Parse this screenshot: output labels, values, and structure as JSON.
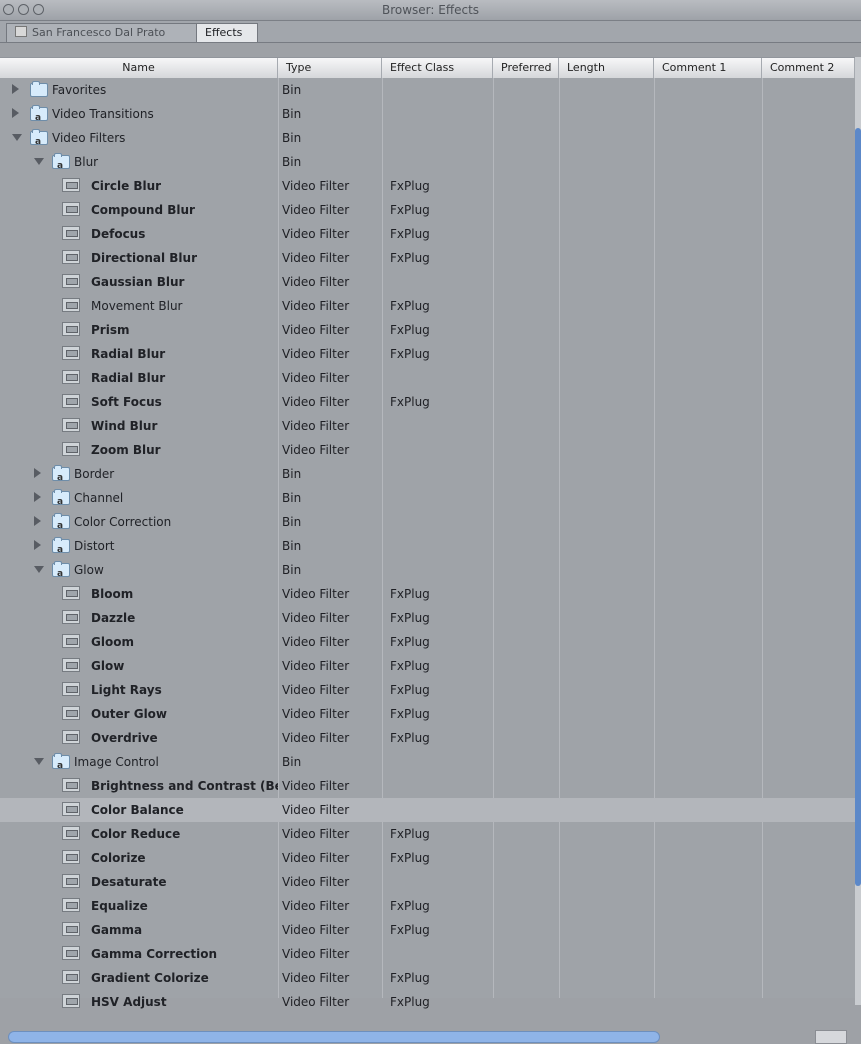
{
  "window_title": "Browser: Effects",
  "tabs": [
    {
      "label": "San Francesco Dal Prato"
    },
    {
      "label": "Effects"
    }
  ],
  "columns": [
    "Name",
    "Type",
    "Effect Class",
    "Preferred",
    "Length",
    "Comment 1",
    "Comment 2"
  ],
  "rows": [
    {
      "name": "Favorites",
      "type": "Bin",
      "class": "",
      "level": 0,
      "disclosure": "collapsed",
      "icon": "folder"
    },
    {
      "name": "Video Transitions",
      "type": "Bin",
      "class": "",
      "level": 0,
      "disclosure": "collapsed",
      "icon": "lock-folder"
    },
    {
      "name": "Video Filters",
      "type": "Bin",
      "class": "",
      "level": 0,
      "disclosure": "expanded",
      "icon": "lock-folder"
    },
    {
      "name": "Blur",
      "type": "Bin",
      "class": "",
      "level": 1,
      "disclosure": "expanded",
      "icon": "lock-folder"
    },
    {
      "name": "Circle Blur",
      "type": "Video Filter",
      "class": "FxPlug",
      "level": 2,
      "icon": "filter",
      "bold": true
    },
    {
      "name": "Compound Blur",
      "type": "Video Filter",
      "class": "FxPlug",
      "level": 2,
      "icon": "filter",
      "bold": true
    },
    {
      "name": "Defocus",
      "type": "Video Filter",
      "class": "FxPlug",
      "level": 2,
      "icon": "filter",
      "bold": true
    },
    {
      "name": "Directional Blur",
      "type": "Video Filter",
      "class": "FxPlug",
      "level": 2,
      "icon": "filter",
      "bold": true
    },
    {
      "name": "Gaussian Blur",
      "type": "Video Filter",
      "class": "",
      "level": 2,
      "icon": "filter",
      "bold": true
    },
    {
      "name": "Movement Blur",
      "type": "Video Filter",
      "class": "FxPlug",
      "level": 2,
      "icon": "filter",
      "bold": false
    },
    {
      "name": "Prism",
      "type": "Video Filter",
      "class": "FxPlug",
      "level": 2,
      "icon": "filter",
      "bold": true
    },
    {
      "name": "Radial Blur",
      "type": "Video Filter",
      "class": "FxPlug",
      "level": 2,
      "icon": "filter",
      "bold": true
    },
    {
      "name": "Radial Blur",
      "type": "Video Filter",
      "class": "",
      "level": 2,
      "icon": "filter",
      "bold": true
    },
    {
      "name": "Soft Focus",
      "type": "Video Filter",
      "class": "FxPlug",
      "level": 2,
      "icon": "filter",
      "bold": true
    },
    {
      "name": "Wind Blur",
      "type": "Video Filter",
      "class": "",
      "level": 2,
      "icon": "filter",
      "bold": true
    },
    {
      "name": "Zoom Blur",
      "type": "Video Filter",
      "class": "",
      "level": 2,
      "icon": "filter",
      "bold": true
    },
    {
      "name": "Border",
      "type": "Bin",
      "class": "",
      "level": 1,
      "disclosure": "collapsed",
      "icon": "lock-folder"
    },
    {
      "name": "Channel",
      "type": "Bin",
      "class": "",
      "level": 1,
      "disclosure": "collapsed",
      "icon": "lock-folder"
    },
    {
      "name": "Color Correction",
      "type": "Bin",
      "class": "",
      "level": 1,
      "disclosure": "collapsed",
      "icon": "lock-folder"
    },
    {
      "name": "Distort",
      "type": "Bin",
      "class": "",
      "level": 1,
      "disclosure": "collapsed",
      "icon": "lock-folder"
    },
    {
      "name": "Glow",
      "type": "Bin",
      "class": "",
      "level": 1,
      "disclosure": "expanded",
      "icon": "lock-folder"
    },
    {
      "name": "Bloom",
      "type": "Video Filter",
      "class": "FxPlug",
      "level": 2,
      "icon": "filter",
      "bold": true
    },
    {
      "name": "Dazzle",
      "type": "Video Filter",
      "class": "FxPlug",
      "level": 2,
      "icon": "filter",
      "bold": true
    },
    {
      "name": "Gloom",
      "type": "Video Filter",
      "class": "FxPlug",
      "level": 2,
      "icon": "filter",
      "bold": true
    },
    {
      "name": "Glow",
      "type": "Video Filter",
      "class": "FxPlug",
      "level": 2,
      "icon": "filter",
      "bold": true
    },
    {
      "name": "Light Rays",
      "type": "Video Filter",
      "class": "FxPlug",
      "level": 2,
      "icon": "filter",
      "bold": true
    },
    {
      "name": "Outer Glow",
      "type": "Video Filter",
      "class": "FxPlug",
      "level": 2,
      "icon": "filter",
      "bold": true
    },
    {
      "name": "Overdrive",
      "type": "Video Filter",
      "class": "FxPlug",
      "level": 2,
      "icon": "filter",
      "bold": true
    },
    {
      "name": "Image Control",
      "type": "Bin",
      "class": "",
      "level": 1,
      "disclosure": "expanded",
      "icon": "lock-folder"
    },
    {
      "name": "Brightness and Contrast (Bezi",
      "type": "Video Filter",
      "class": "",
      "level": 2,
      "icon": "filter",
      "bold": true
    },
    {
      "name": "Color Balance",
      "type": "Video Filter",
      "class": "",
      "level": 2,
      "icon": "filter",
      "bold": true,
      "selected": true
    },
    {
      "name": "Color Reduce",
      "type": "Video Filter",
      "class": "FxPlug",
      "level": 2,
      "icon": "filter",
      "bold": true
    },
    {
      "name": "Colorize",
      "type": "Video Filter",
      "class": "FxPlug",
      "level": 2,
      "icon": "filter",
      "bold": true
    },
    {
      "name": "Desaturate",
      "type": "Video Filter",
      "class": "",
      "level": 2,
      "icon": "filter",
      "bold": true
    },
    {
      "name": "Equalize",
      "type": "Video Filter",
      "class": "FxPlug",
      "level": 2,
      "icon": "filter",
      "bold": true
    },
    {
      "name": "Gamma",
      "type": "Video Filter",
      "class": "FxPlug",
      "level": 2,
      "icon": "filter",
      "bold": true
    },
    {
      "name": "Gamma Correction",
      "type": "Video Filter",
      "class": "",
      "level": 2,
      "icon": "filter",
      "bold": true
    },
    {
      "name": "Gradient Colorize",
      "type": "Video Filter",
      "class": "FxPlug",
      "level": 2,
      "icon": "filter",
      "bold": true
    },
    {
      "name": "HSV Adjust",
      "type": "Video Filter",
      "class": "FxPlug",
      "level": 2,
      "icon": "filter",
      "bold": true
    }
  ]
}
